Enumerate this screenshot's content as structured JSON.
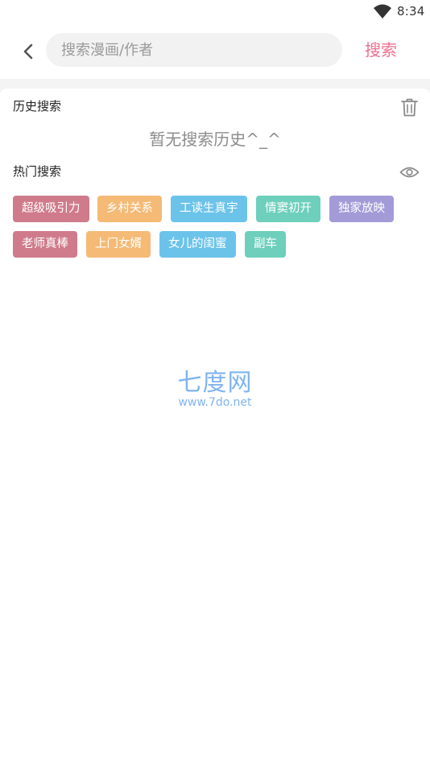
{
  "status": {
    "time": "8:34",
    "wifi_icon": "wifi-icon"
  },
  "search": {
    "placeholder": "搜索漫画/作者",
    "value": "",
    "button_label": "搜索",
    "back_icon": "chevron-left-icon"
  },
  "history": {
    "title": "历史搜索",
    "empty_text": "暂无搜索历史^_^",
    "clear_icon": "trash-icon"
  },
  "hot": {
    "title": "热门搜索",
    "toggle_icon": "eye-icon",
    "tags": [
      {
        "label": "超级吸引力",
        "color": "#cf7b8b"
      },
      {
        "label": "乡村关系",
        "color": "#f4ba76"
      },
      {
        "label": "工读生真宇",
        "color": "#6cc3ea"
      },
      {
        "label": "情窦初开",
        "color": "#6dcfbc"
      },
      {
        "label": "独家放映",
        "color": "#a39bd7"
      },
      {
        "label": "老师真棒",
        "color": "#cf7b8b"
      },
      {
        "label": "上门女婿",
        "color": "#f4ba76"
      },
      {
        "label": "女儿的闺蜜",
        "color": "#6cc3ea"
      },
      {
        "label": "副车",
        "color": "#6dcfbc"
      }
    ]
  },
  "watermark": {
    "main": "七度网",
    "sub": "www.7do.net"
  },
  "colors": {
    "accent": "#ef6f8f",
    "background": "#f4f4f4",
    "watermark": "#7fb4ee"
  }
}
